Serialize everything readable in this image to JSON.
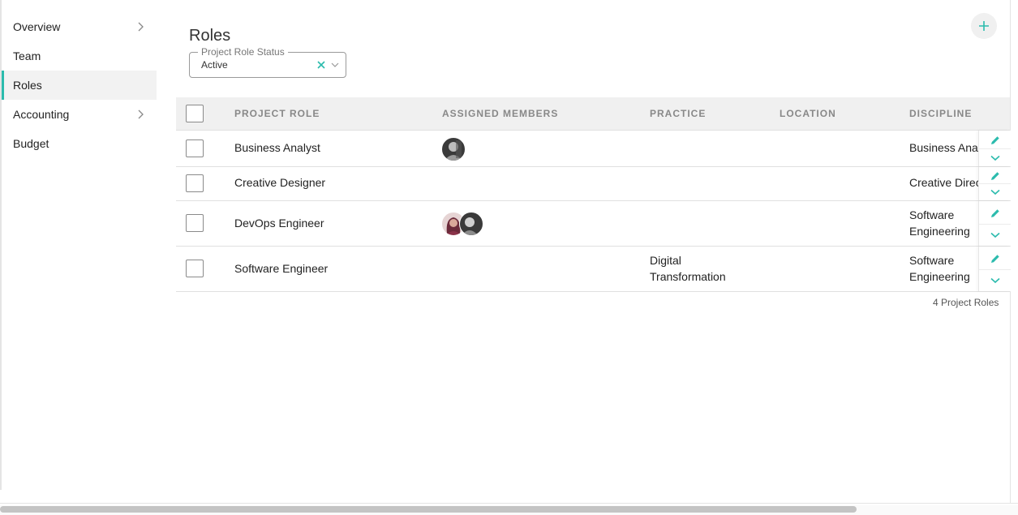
{
  "sidebar": {
    "items": [
      {
        "label": "Overview",
        "has_chevron": true
      },
      {
        "label": "Team",
        "has_chevron": false
      },
      {
        "label": "Roles",
        "has_chevron": false,
        "active": true
      },
      {
        "label": "Accounting",
        "has_chevron": true
      },
      {
        "label": "Budget",
        "has_chevron": false
      }
    ]
  },
  "header": {
    "title": "Roles",
    "add_icon": "plus-icon"
  },
  "filter": {
    "label": "Project Role Status",
    "value": "Active",
    "clear_icon": "close-icon",
    "caret_icon": "chevron-down-icon"
  },
  "table": {
    "columns": {
      "role": "PROJECT ROLE",
      "members": "ASSIGNED MEMBERS",
      "practice": "PRACTICE",
      "location": "LOCATION",
      "discipline": "DISCIPLINE"
    },
    "rows": [
      {
        "role": "Business Analyst",
        "members": 1,
        "practice": "",
        "location": "",
        "discipline": "Business Analyst"
      },
      {
        "role": "Creative Designer",
        "members": 0,
        "practice": "",
        "location": "",
        "discipline": "Creative Director"
      },
      {
        "role": "DevOps Engineer",
        "members": 2,
        "practice": "",
        "location": "",
        "discipline": [
          "Software",
          "Engineering"
        ]
      },
      {
        "role": "Software Engineer",
        "members": 0,
        "practice": [
          "Digital",
          "Transformation"
        ],
        "location": "",
        "discipline": [
          "Software",
          "Engineering"
        ]
      }
    ],
    "row_edit_icon": "pencil-icon",
    "row_expand_icon": "chevron-down-icon",
    "count_label": "4 Project Roles"
  },
  "colors": {
    "accent": "#2bbbad",
    "header_bg": "#f0f0f0",
    "active_item_bg": "#f2f2f2"
  }
}
